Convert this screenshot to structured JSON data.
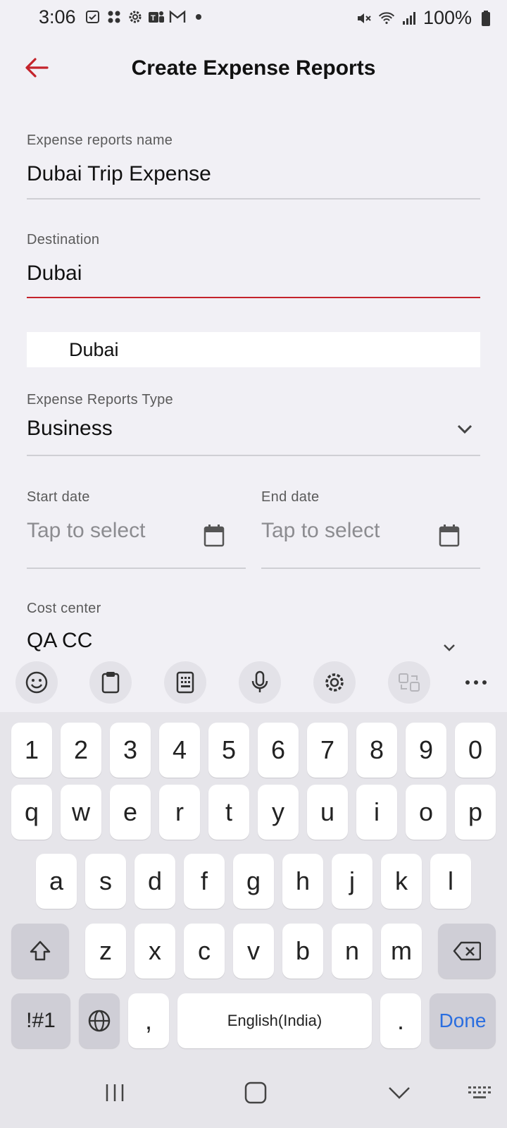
{
  "status_bar": {
    "time": "3:06",
    "battery": "100%",
    "left_icons": [
      "notification-icon",
      "apps-icon",
      "settings-icon",
      "teams-icon",
      "gmail-icon",
      "dot-icon"
    ],
    "right_icons": [
      "mute-icon",
      "wifi-icon",
      "signal-icon",
      "battery-icon"
    ]
  },
  "header": {
    "title": "Create Expense Reports",
    "accent_color": "#c4232b"
  },
  "form": {
    "name_label": "Expense reports name",
    "name_value": "Dubai Trip Expense",
    "destination_label": "Destination",
    "destination_value": "Dubai",
    "suggestion": "Dubai",
    "type_label": "Expense Reports Type",
    "type_value": "Business",
    "start_label": "Start date",
    "start_placeholder": "Tap to select",
    "end_label": "End date",
    "end_placeholder": "Tap to select",
    "cost_center_label": "Cost center",
    "cost_center_value": "QA CC"
  },
  "keyboard": {
    "number_row": [
      "1",
      "2",
      "3",
      "4",
      "5",
      "6",
      "7",
      "8",
      "9",
      "0"
    ],
    "row1": [
      "q",
      "w",
      "e",
      "r",
      "t",
      "y",
      "u",
      "i",
      "o",
      "p"
    ],
    "row2": [
      "a",
      "s",
      "d",
      "f",
      "g",
      "h",
      "j",
      "k",
      "l"
    ],
    "row3": [
      "z",
      "x",
      "c",
      "v",
      "b",
      "n",
      "m"
    ],
    "symbols": "!#1",
    "comma": ",",
    "space": "English(India)",
    "period": ".",
    "done": "Done"
  }
}
